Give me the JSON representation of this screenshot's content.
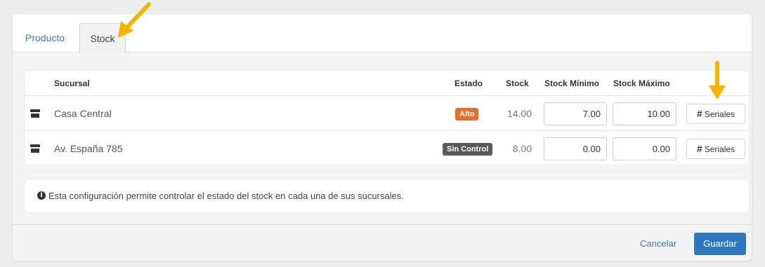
{
  "tabs": [
    {
      "label": "Producto",
      "active": false
    },
    {
      "label": "Stock",
      "active": true
    }
  ],
  "table": {
    "headers": {
      "sucursal": "Sucursal",
      "estado": "Estado",
      "stock": "Stock",
      "stock_min": "Stock Mínimo",
      "stock_max": "Stock Máximo"
    },
    "rows": [
      {
        "icon": "store-icon",
        "sucursal": "Casa Central",
        "estado": "Alto",
        "estado_color": "#e4702f",
        "stock": "14.00",
        "stock_min": "7.00",
        "stock_max": "10.00",
        "serial_icon": "#",
        "serial_label": "Seriales"
      },
      {
        "icon": "store-icon",
        "sucursal": "Av. España 785",
        "estado": "Sin Control",
        "estado_color": "#5a5a5a",
        "stock": "8.00",
        "stock_min": "0.00",
        "stock_max": "0.00",
        "serial_icon": "#",
        "serial_label": "Seriales"
      }
    ]
  },
  "info": {
    "icon": "info-circle-icon",
    "text": "Esta configuración permite controlar el estado del stock en cada una de sus sucursales."
  },
  "footer": {
    "cancel_label": "Cancelar",
    "save_label": "Guardar"
  },
  "colors": {
    "accent": "#2f78c1",
    "link": "#3a7ab8",
    "annotation_arrow": "#f5b400"
  }
}
